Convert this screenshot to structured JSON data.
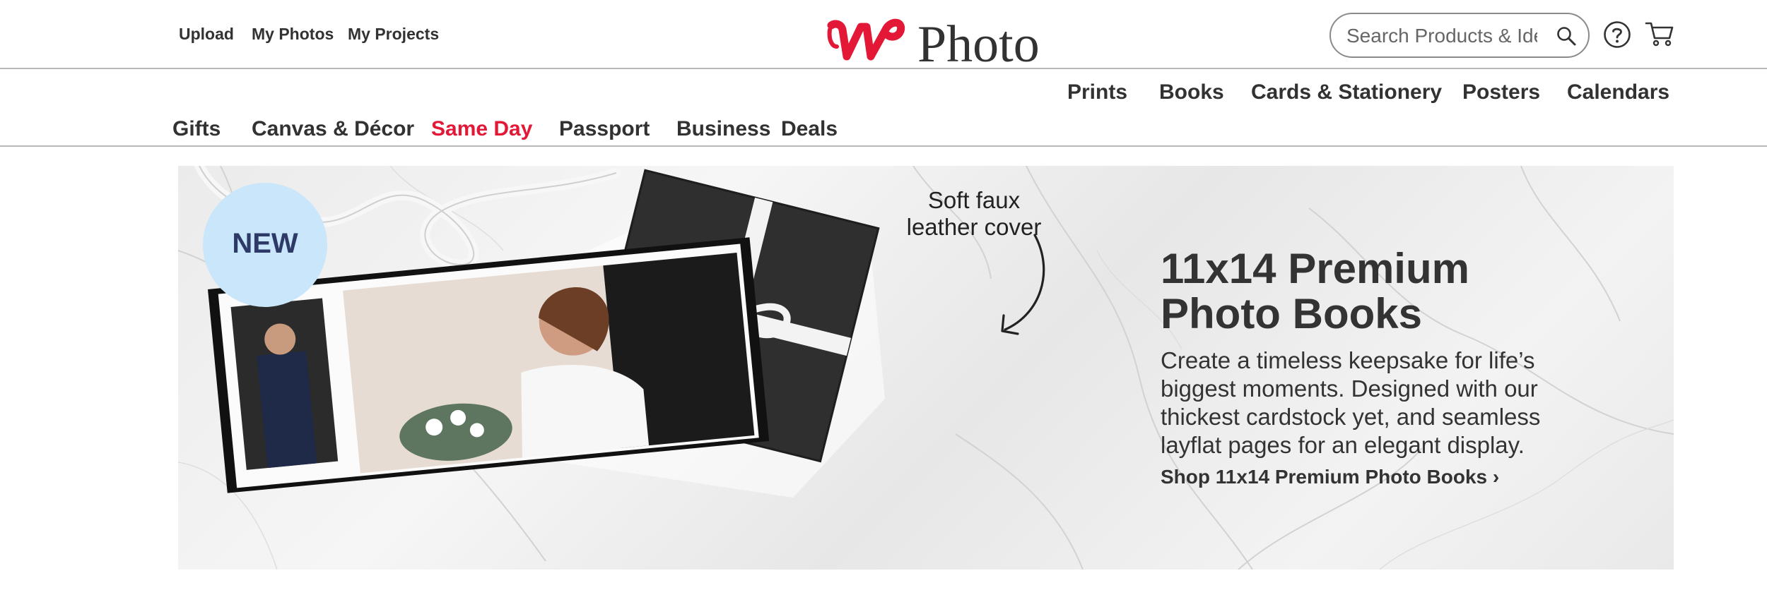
{
  "header": {
    "util_links": [
      "Upload",
      "My Photos",
      "My Projects"
    ],
    "logo_text": "Photo",
    "search": {
      "placeholder": "Search Products & Ideas"
    }
  },
  "nav": {
    "row1": [
      "Prints",
      "Books",
      "Cards & Stationery",
      "Posters",
      "Calendars"
    ],
    "row2": [
      "Gifts",
      "Canvas & Décor",
      "Same Day",
      "Passport",
      "Business",
      "Deals"
    ]
  },
  "hero": {
    "badge": "NEW",
    "annotation_line1": "Soft faux",
    "annotation_line2": "leather cover",
    "title_line1": "11x14 Premium",
    "title_line2": "Photo Books",
    "body": "Create a timeless keepsake for life’s biggest moments. Designed with our thickest cardstock yet, and seamless layflat pages for an elegant display.",
    "cta": "Shop 11x14 Premium Photo Books ›"
  },
  "colors": {
    "brand_red": "#e31837",
    "text": "#323232",
    "badge_bg": "#c9e6fa",
    "badge_text": "#2d3a67"
  },
  "icons": [
    "walgreens-w-logo",
    "search-icon",
    "help-icon",
    "cart-icon",
    "arrow-icon"
  ]
}
